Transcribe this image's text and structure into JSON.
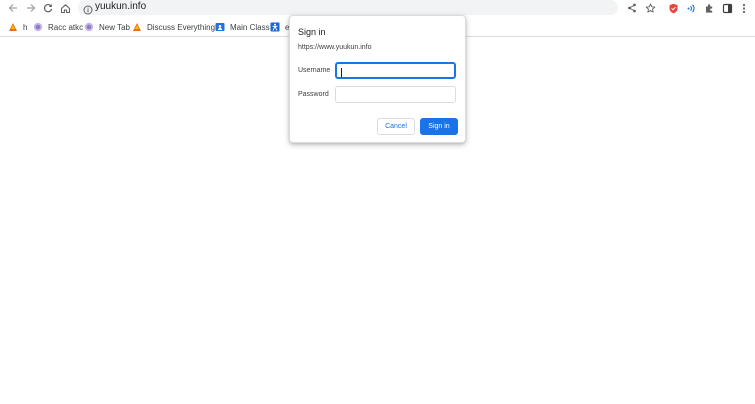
{
  "browser": {
    "address_bar": {
      "url": "yuukun.info",
      "icon": "info-icon"
    },
    "nav": [
      "back-icon",
      "forward-icon",
      "reload-icon",
      "home-icon"
    ],
    "toolbar_icons": [
      "share-icon",
      "bookmark-star-icon",
      "shield-extension-icon",
      "audio-extension-icon",
      "puzzle-extensions-icon",
      "side-panel-icon",
      "more-menu-icon"
    ]
  },
  "bookmarks": [
    {
      "label": "h",
      "icon": "orange-leaf-icon"
    },
    {
      "label": "Racc atkc",
      "icon": "globe-icon"
    },
    {
      "label": "New Tab",
      "icon": "globe-icon"
    },
    {
      "label": "Discuss Everything...",
      "icon": "orange-leaf-icon"
    },
    {
      "label": "Main Class",
      "icon": "classroom-icon"
    },
    {
      "label": "e",
      "icon": "accessibility-icon"
    }
  ],
  "dialog": {
    "title": "Sign in",
    "origin": "https://www.yuukun.info",
    "username_label": "Username",
    "username_value": "",
    "password_label": "Password",
    "password_value": "",
    "cancel_label": "Cancel",
    "signin_label": "Sign in"
  },
  "colors": {
    "accent": "#1a73e8",
    "omnibox_bg": "#f1f3f4",
    "border": "#dadce0"
  }
}
